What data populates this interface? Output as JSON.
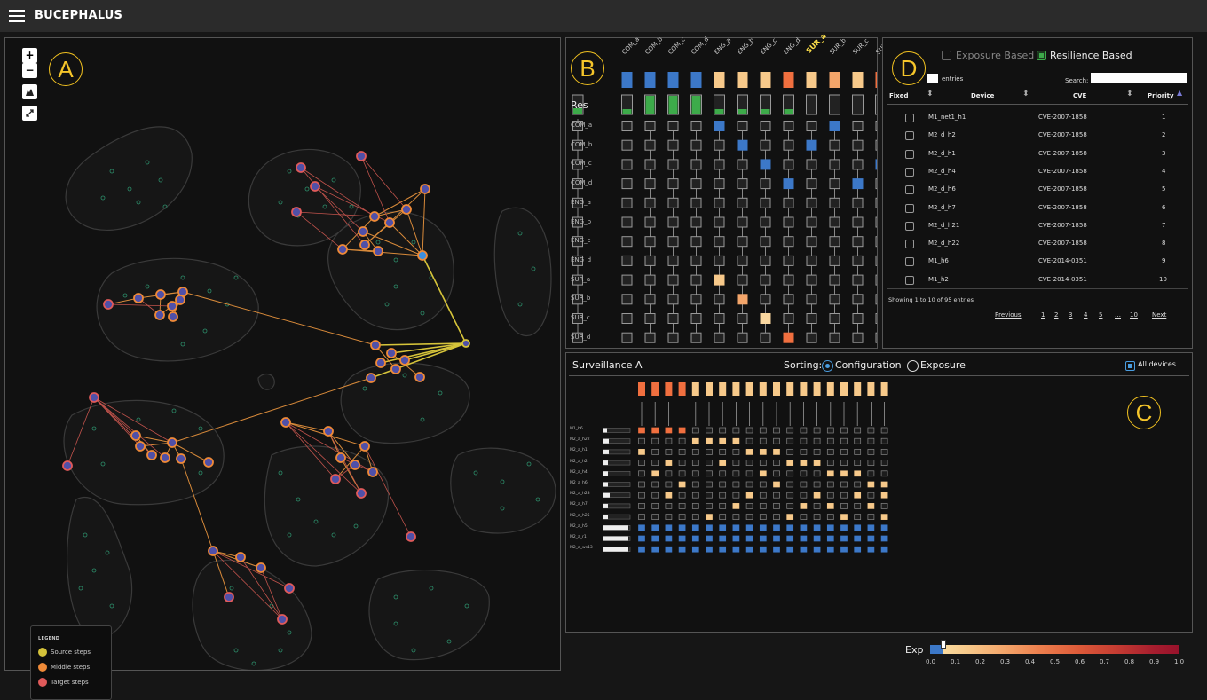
{
  "app": {
    "title": "BUCEPHALUS"
  },
  "panels": {
    "a_badge": "A",
    "b_badge": "B",
    "c_badge": "C",
    "d_badge": "D"
  },
  "map_controls": {
    "zoom_in": "+",
    "zoom_out": "−"
  },
  "legend": {
    "title": "LEGEND",
    "items": [
      {
        "label": "Source steps",
        "color": "#d4c23a"
      },
      {
        "label": "Middle steps",
        "color": "#ef8a38"
      },
      {
        "label": "Target steps",
        "color": "#e05a5a"
      }
    ]
  },
  "matrix_b": {
    "columns": [
      "COM_a",
      "COM_b",
      "COM_c",
      "COM_d",
      "ENG_a",
      "ENG_b",
      "ENG_c",
      "ENG_d",
      "SUR_a",
      "SUR_b",
      "SUR_c",
      "SUR_d"
    ],
    "highlight_column": "SUR_a",
    "res_label": "Res",
    "rows": [
      "COM_a",
      "COM_b",
      "COM_c",
      "COM_d",
      "ENG_a",
      "ENG_b",
      "ENG_c",
      "ENG_d",
      "SUR_a",
      "SUR_b",
      "SUR_c",
      "SUR_d"
    ]
  },
  "table_d": {
    "exposure_label": "Exposure Based",
    "resilience_label": "Resilience Based",
    "entries_label": "entries",
    "search_label": "Search:",
    "search_value": "",
    "headers": {
      "fixed": "Fixed",
      "device": "Device",
      "cve": "CVE",
      "priority": "Priority"
    },
    "rows": [
      {
        "device": "M1_net1_h1",
        "cve": "CVE-2007-1858",
        "priority": "1"
      },
      {
        "device": "M2_d_h2",
        "cve": "CVE-2007-1858",
        "priority": "2"
      },
      {
        "device": "M2_d_h1",
        "cve": "CVE-2007-1858",
        "priority": "3"
      },
      {
        "device": "M2_d_h4",
        "cve": "CVE-2007-1858",
        "priority": "4"
      },
      {
        "device": "M2_d_h6",
        "cve": "CVE-2007-1858",
        "priority": "5"
      },
      {
        "device": "M2_d_h7",
        "cve": "CVE-2007-1858",
        "priority": "6"
      },
      {
        "device": "M2_d_h21",
        "cve": "CVE-2007-1858",
        "priority": "7"
      },
      {
        "device": "M2_d_h22",
        "cve": "CVE-2007-1858",
        "priority": "8"
      },
      {
        "device": "M1_h6",
        "cve": "CVE-2014-0351",
        "priority": "9"
      },
      {
        "device": "M1_h2",
        "cve": "CVE-2014-0351",
        "priority": "10"
      }
    ],
    "info": "Showing 1 to 10 of 95 entries",
    "pagination": [
      "Previous",
      "1",
      "2",
      "3",
      "4",
      "5",
      "…",
      "10",
      "Next"
    ]
  },
  "panel_c": {
    "title": "Surveillance A",
    "sorting_label": "Sorting:",
    "option_configuration": "Configuration",
    "option_exposure": "Exposure",
    "all_devices_label": "All devices",
    "rows": [
      "M1_h6",
      "M2_a_h22",
      "M2_a_h1",
      "M2_a_h2",
      "M2_a_h4",
      "M2_a_h6",
      "M2_a_h23",
      "M2_a_h7",
      "M2_a_h25",
      "M2_a_h5",
      "M2_a_r1",
      "M2_a_ws13"
    ]
  },
  "exposure_scale": {
    "label": "Exp",
    "ticks": [
      "0.0",
      "0.1",
      "0.2",
      "0.3",
      "0.4",
      "0.5",
      "0.6",
      "0.7",
      "0.8",
      "0.9",
      "1.0"
    ],
    "marker_value": 0.05
  },
  "colors": {
    "accent": "#f5c52a",
    "orange": "#ef8a38",
    "blue": "#3c78c8",
    "green": "#3dab4a",
    "highlight": "#ffe14a"
  }
}
